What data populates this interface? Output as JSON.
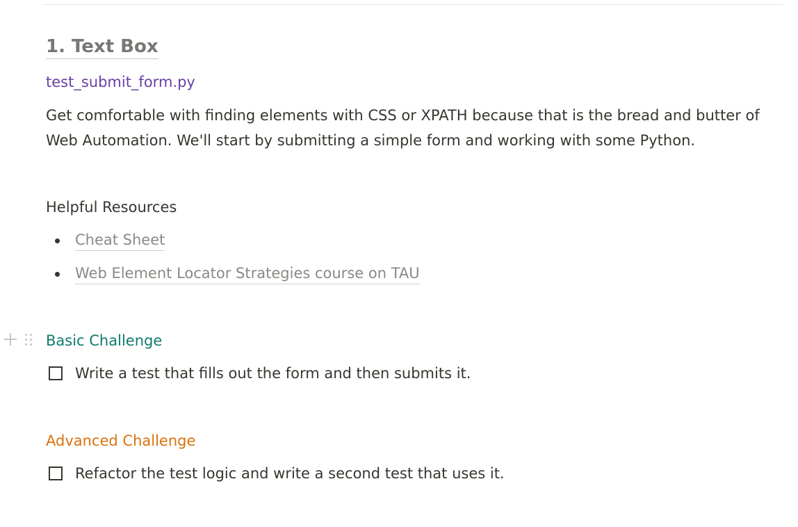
{
  "section": {
    "heading": "1. Text Box",
    "filename": "test_submit_form.py",
    "description": "Get comfortable with finding elements with CSS or XPATH because that is the bread and butter of Web Automation. We'll start by submitting a simple form and working with some Python."
  },
  "resources": {
    "title": "Helpful Resources",
    "links": [
      {
        "label": "Cheat Sheet"
      },
      {
        "label": "Web Element Locator Strategies course on TAU"
      }
    ]
  },
  "basic": {
    "title": "Basic Challenge",
    "title_color": "#0f7b6c",
    "todo": "Write a test that fills out the form and then submits it.",
    "checked": false
  },
  "advanced": {
    "title": "Advanced Challenge",
    "title_color": "#d9730d",
    "todo": "Refactor the test logic and write a second test that uses it.",
    "checked": false
  },
  "colors": {
    "filename": "#6940a5",
    "heading": "#787774",
    "text": "#37352f"
  },
  "icons": {
    "add_block": "plus-icon",
    "drag_handle": "drag-handle-icon"
  }
}
